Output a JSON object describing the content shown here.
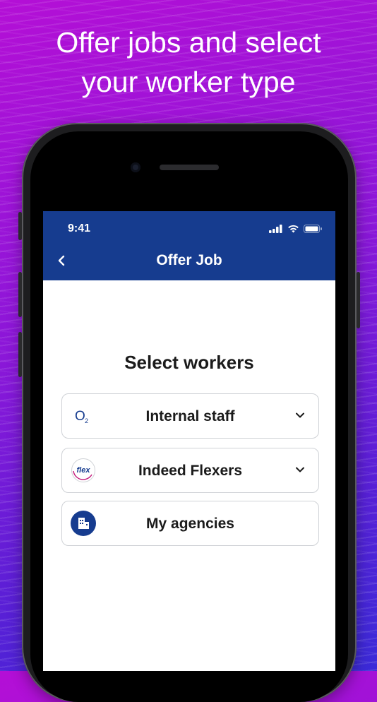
{
  "promo": {
    "headline_line1": "Offer jobs and select",
    "headline_line2": "your worker type"
  },
  "status_bar": {
    "time": "9:41"
  },
  "header": {
    "title": "Offer Job"
  },
  "content": {
    "section_title": "Select workers",
    "options": [
      {
        "label": "Internal staff",
        "logo": "o2-logo",
        "logo_text": "O",
        "logo_sub": "2",
        "expandable": true
      },
      {
        "label": "Indeed Flexers",
        "logo": "flex-logo",
        "logo_text": "flex",
        "expandable": true
      },
      {
        "label": "My agencies",
        "logo": "building-icon",
        "expandable": false
      }
    ]
  },
  "colors": {
    "app_bar": "#163c8f",
    "background_start": "#b40fd6",
    "background_end": "#3b2ad8",
    "flex_pink": "#c2187a"
  }
}
